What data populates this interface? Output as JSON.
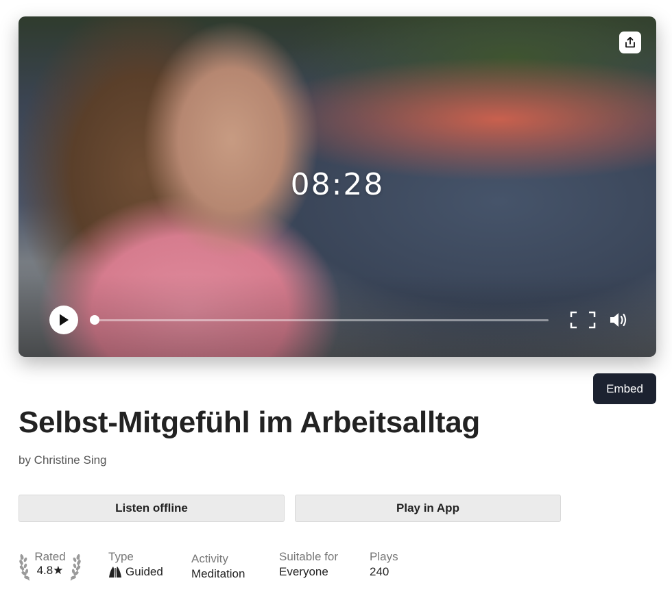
{
  "player": {
    "timer": "08:28",
    "progress": 0.0,
    "icons": {
      "share": "share-icon",
      "play": "play-icon",
      "fullscreen": "fullscreen-icon",
      "volume": "volume-icon"
    }
  },
  "embed_label": "Embed",
  "title": "Selbst-Mitgefühl im Arbeitsalltag",
  "byline": "by Christine Sing",
  "actions": {
    "listen_offline": "Listen offline",
    "play_in_app": "Play in App"
  },
  "stats": {
    "rated": {
      "label": "Rated",
      "value": "4.8★"
    },
    "type": {
      "label": "Type",
      "value": "Guided",
      "icon": "guided-icon"
    },
    "activity": {
      "label": "Activity",
      "value": "Meditation"
    },
    "suitable": {
      "label": "Suitable for",
      "value": "Everyone"
    },
    "plays": {
      "label": "Plays",
      "value": "240"
    }
  },
  "colors": {
    "embed_bg": "#1c2230",
    "button_bg": "#ebebeb",
    "title": "#222222"
  }
}
